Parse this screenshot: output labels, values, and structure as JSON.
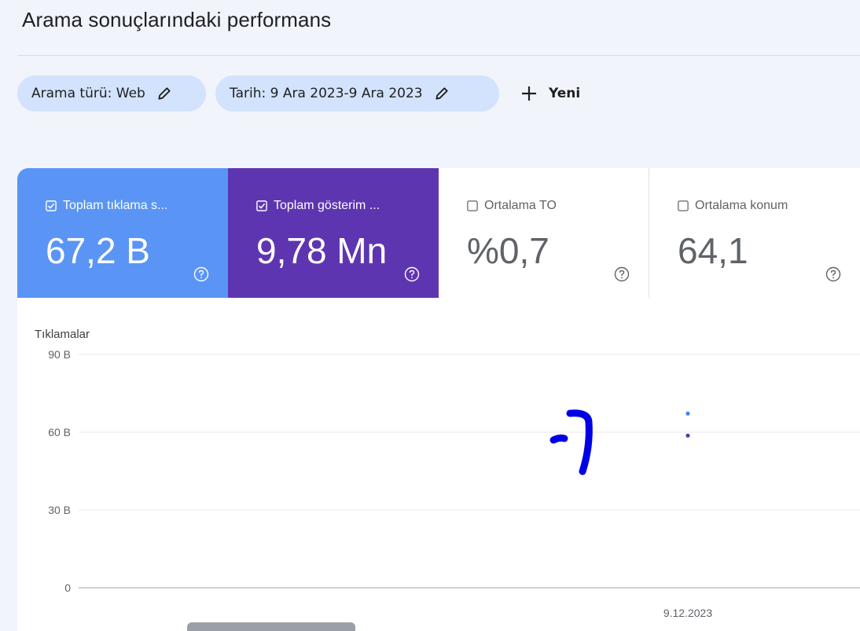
{
  "page": {
    "title": "Arama sonuçlarındaki performans"
  },
  "filters": {
    "search_type": "Arama türü: Web",
    "date": "Tarih: 9 Ara 2023-9 Ara 2023",
    "new_label": "Yeni"
  },
  "metrics": [
    {
      "label": "Toplam tıklama s...",
      "value": "67,2 B",
      "checked": true,
      "color": "#5a95f5"
    },
    {
      "label": "Toplam gösterim ...",
      "value": "9,78 Mn",
      "checked": true,
      "color": "#5e35b1"
    },
    {
      "label": "Ortalama TO",
      "value": "%0,7",
      "checked": false
    },
    {
      "label": "Ortalama konum",
      "value": "64,1",
      "checked": false
    }
  ],
  "chart_data": {
    "type": "scatter",
    "ylabel": "Tıklamalar",
    "y_ticks": [
      "90 B",
      "60 B",
      "30 B",
      "0"
    ],
    "ylim": [
      0,
      90000
    ],
    "x_ticks": [
      "9.12.2023"
    ],
    "grid": true,
    "series": [
      {
        "color": "#4285f4",
        "points": [
          {
            "x": "9.12.2023",
            "y": 67200
          }
        ]
      },
      {
        "color": "#5e35b1",
        "points": [
          {
            "x": "9.12.2023",
            "y": 58700
          }
        ]
      }
    ]
  }
}
